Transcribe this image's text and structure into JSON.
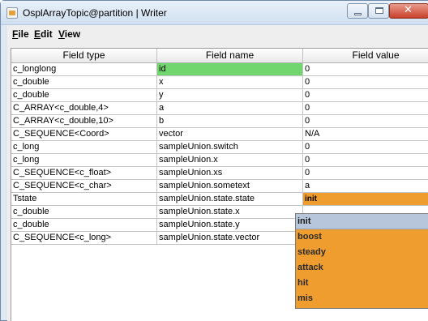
{
  "window": {
    "title": "OsplArrayTopic@partition | Writer"
  },
  "menu": {
    "file": "File",
    "edit": "Edit",
    "view": "View"
  },
  "table": {
    "headers": [
      "Field type",
      "Field name",
      "Field value"
    ],
    "rows": [
      {
        "type": "c_longlong",
        "name": "id",
        "value": "0"
      },
      {
        "type": "c_double",
        "name": "x",
        "value": "0"
      },
      {
        "type": "c_double",
        "name": "y",
        "value": "0"
      },
      {
        "type": "C_ARRAY<c_double,4>",
        "name": "a",
        "value": "0"
      },
      {
        "type": "C_ARRAY<c_double,10>",
        "name": "b",
        "value": "0"
      },
      {
        "type": "C_SEQUENCE<Coord>",
        "name": "vector",
        "value": "N/A"
      },
      {
        "type": "c_long",
        "name": "sampleUnion.switch",
        "value": "0"
      },
      {
        "type": "c_long",
        "name": "sampleUnion.x",
        "value": "0"
      },
      {
        "type": "C_SEQUENCE<c_float>",
        "name": "sampleUnion.xs",
        "value": "0"
      },
      {
        "type": "C_SEQUENCE<c_char>",
        "name": "sampleUnion.sometext",
        "value": "a"
      },
      {
        "type": "Tstate",
        "name": "sampleUnion.state.state",
        "value": "init"
      },
      {
        "type": "c_double",
        "name": "sampleUnion.state.x",
        "value": ""
      },
      {
        "type": "c_double",
        "name": "sampleUnion.state.y",
        "value": ""
      },
      {
        "type": "C_SEQUENCE<c_long>",
        "name": "sampleUnion.state.vector",
        "value": ""
      }
    ]
  },
  "dropdown": {
    "options": [
      "init",
      "boost",
      "steady",
      "attack",
      "hit",
      "mis"
    ],
    "selected": "init"
  },
  "colors": {
    "highlight": "#72d66f",
    "editing": "#f09d2f",
    "selected_option": "#b7c6da"
  }
}
